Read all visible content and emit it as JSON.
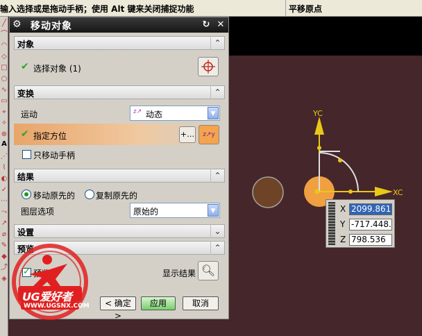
{
  "statusbar": {
    "prompt": "输入选择或是拖动手柄；使用 Alt 键来关闭捕捉功能",
    "right": "平移原点"
  },
  "dialog": {
    "title": "移动对象",
    "sections": {
      "object": "对象",
      "transform": "变换",
      "result": "结果",
      "settings": "设置",
      "preview": "预览"
    },
    "select_object": "选择对象 (1)",
    "motion_label": "运动",
    "motion_value": "动态",
    "orient_label": "指定方位",
    "move_handle_only": "只移动手柄",
    "move_original": "移动原先的",
    "copy_original": "复制原先的",
    "layer_label": "图层选项",
    "layer_value": "原始的",
    "preview_label": "预览",
    "show_result": "显示结果",
    "ok": "< 确定 >",
    "apply": "应用",
    "cancel": "取消"
  },
  "coords": {
    "x_label": "X",
    "x_value": "2099.861",
    "y_label": "Y",
    "y_value": "-717.448.",
    "z_label": "Z",
    "z_value": "798.536"
  },
  "axes": {
    "yc": "YC",
    "xc": "XC"
  },
  "watermark": {
    "brand": "UG爱好者",
    "url": "WWW.UGSNX.COM"
  },
  "colors": {
    "viewport": "#45262a",
    "accent_orange": "#f0a040",
    "axis_yellow": "#e8c818",
    "check_green": "#2aa52a"
  }
}
